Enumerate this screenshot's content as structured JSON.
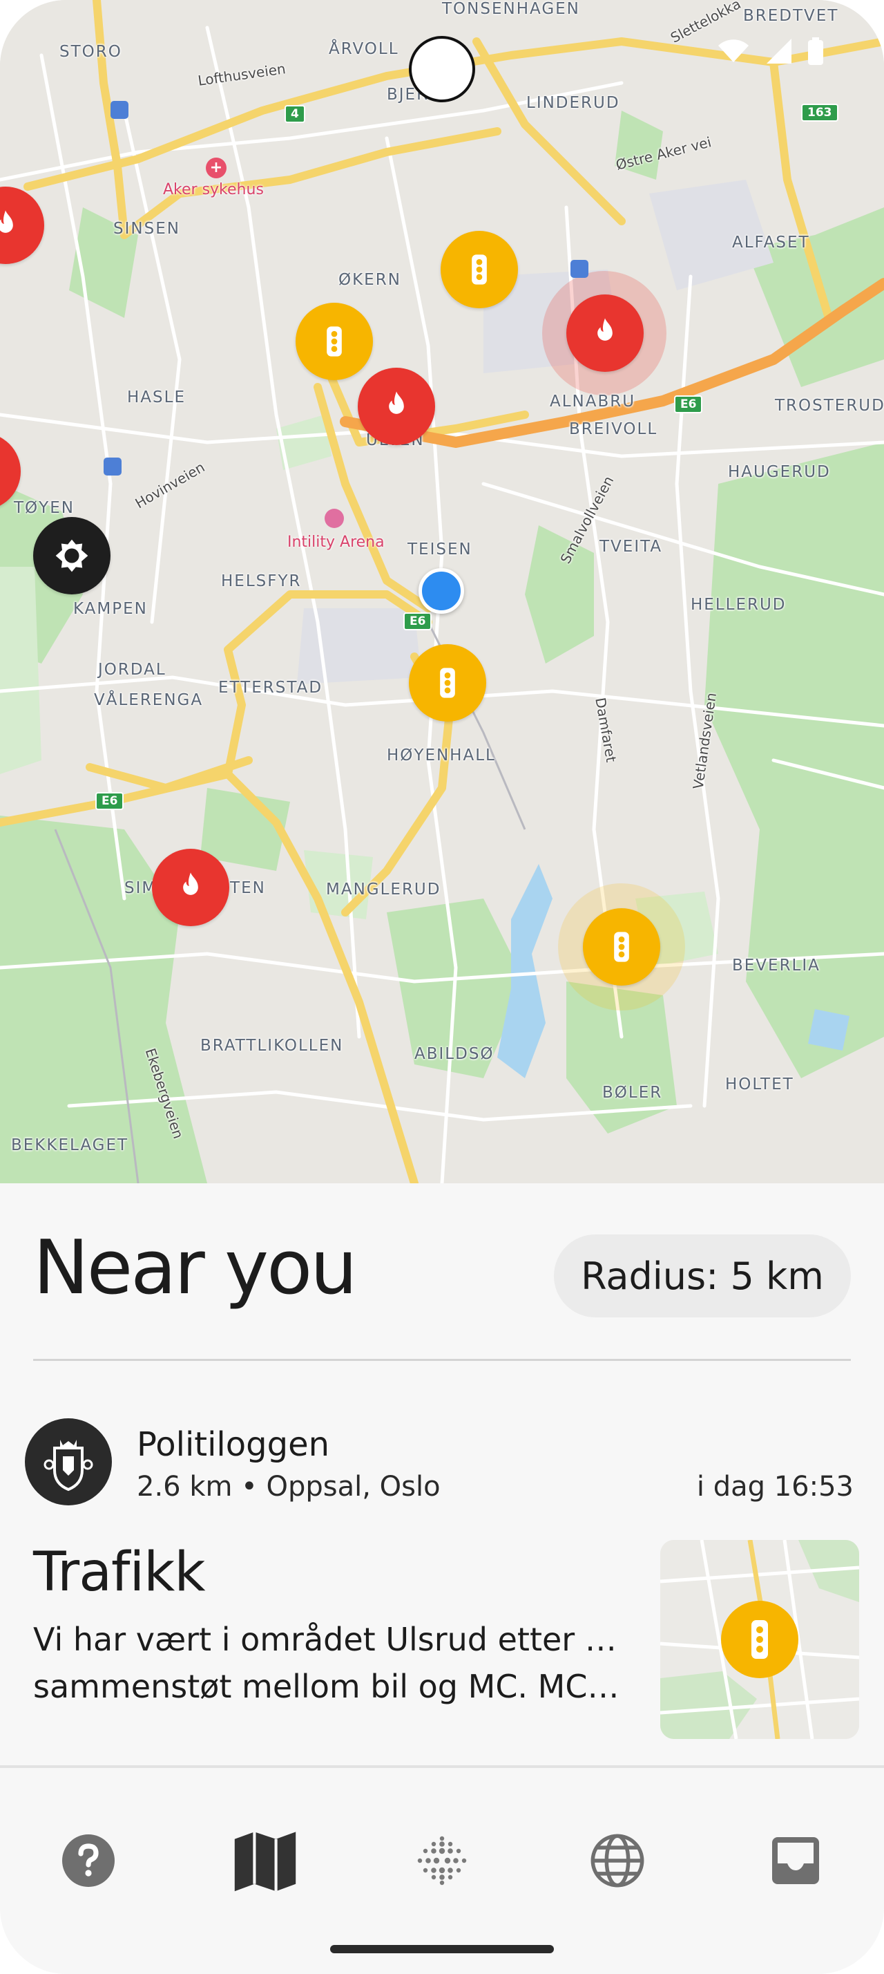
{
  "map": {
    "places": [
      "TONSENHAGEN",
      "STORO",
      "ÅRVOLL",
      "BJERKE",
      "LINDERUD",
      "BREDTVET",
      "SINSEN",
      "ØKERN",
      "ALFASET",
      "ALNABRU",
      "HASLE",
      "ULVEN",
      "TROSTERUD",
      "BREIVOLL",
      "HAUGERUD",
      "TØYEN",
      "TEISEN",
      "TVEITA",
      "HELSFYR",
      "KAMPEN",
      "HELLERUD",
      "JORDAL",
      "VÅLERENGA",
      "ETTERSTAD",
      "HØYENHALL",
      "SIMENSBRÅTEN",
      "MANGLERUD",
      "BEVERLIA",
      "BRATTLIKOLLEN",
      "ABILDSØ",
      "HOLTET",
      "BØLER",
      "BEKKELAGET"
    ],
    "streets": [
      "Lofthusveien",
      "Østre Aker vei",
      "Slettelokka",
      "Hovinveien",
      "Smalvollveien",
      "Damfaret",
      "Vetlandsveien",
      "Ekebergveien"
    ],
    "pois": [
      "Aker sykehus",
      "Intility Arena"
    ],
    "shields": [
      "4",
      "163",
      "E6",
      "E6",
      "E6"
    ],
    "markers": [
      {
        "type": "fire",
        "icon": "flame-icon"
      },
      {
        "type": "traffic",
        "icon": "traffic-light-icon"
      },
      {
        "type": "police",
        "icon": "police-emblem-icon"
      }
    ],
    "colors": {
      "fire": "#e8352f",
      "traffic": "#f7b500",
      "police": "#1e1e1e",
      "you": "#2d8cf0"
    }
  },
  "sheet": {
    "title": "Near you",
    "radius_label": "Radius: 5 km"
  },
  "card": {
    "source": "Politiloggen",
    "meta": "2.6 km • Oppsal, Oslo",
    "time": "i dag 16:53",
    "title": "Trafikk",
    "body_line1": "Vi har vært i området Ulsrud etter ett",
    "body_line2": "sammenstøt mellom bil og MC. MC f…",
    "thumb_icon": "traffic-light-icon"
  },
  "nav": {
    "items": [
      {
        "name": "help",
        "icon": "question-icon"
      },
      {
        "name": "map",
        "icon": "map-icon"
      },
      {
        "name": "feed",
        "icon": "dots-grid-icon"
      },
      {
        "name": "world",
        "icon": "globe-icon"
      },
      {
        "name": "inbox",
        "icon": "inbox-icon"
      }
    ]
  }
}
